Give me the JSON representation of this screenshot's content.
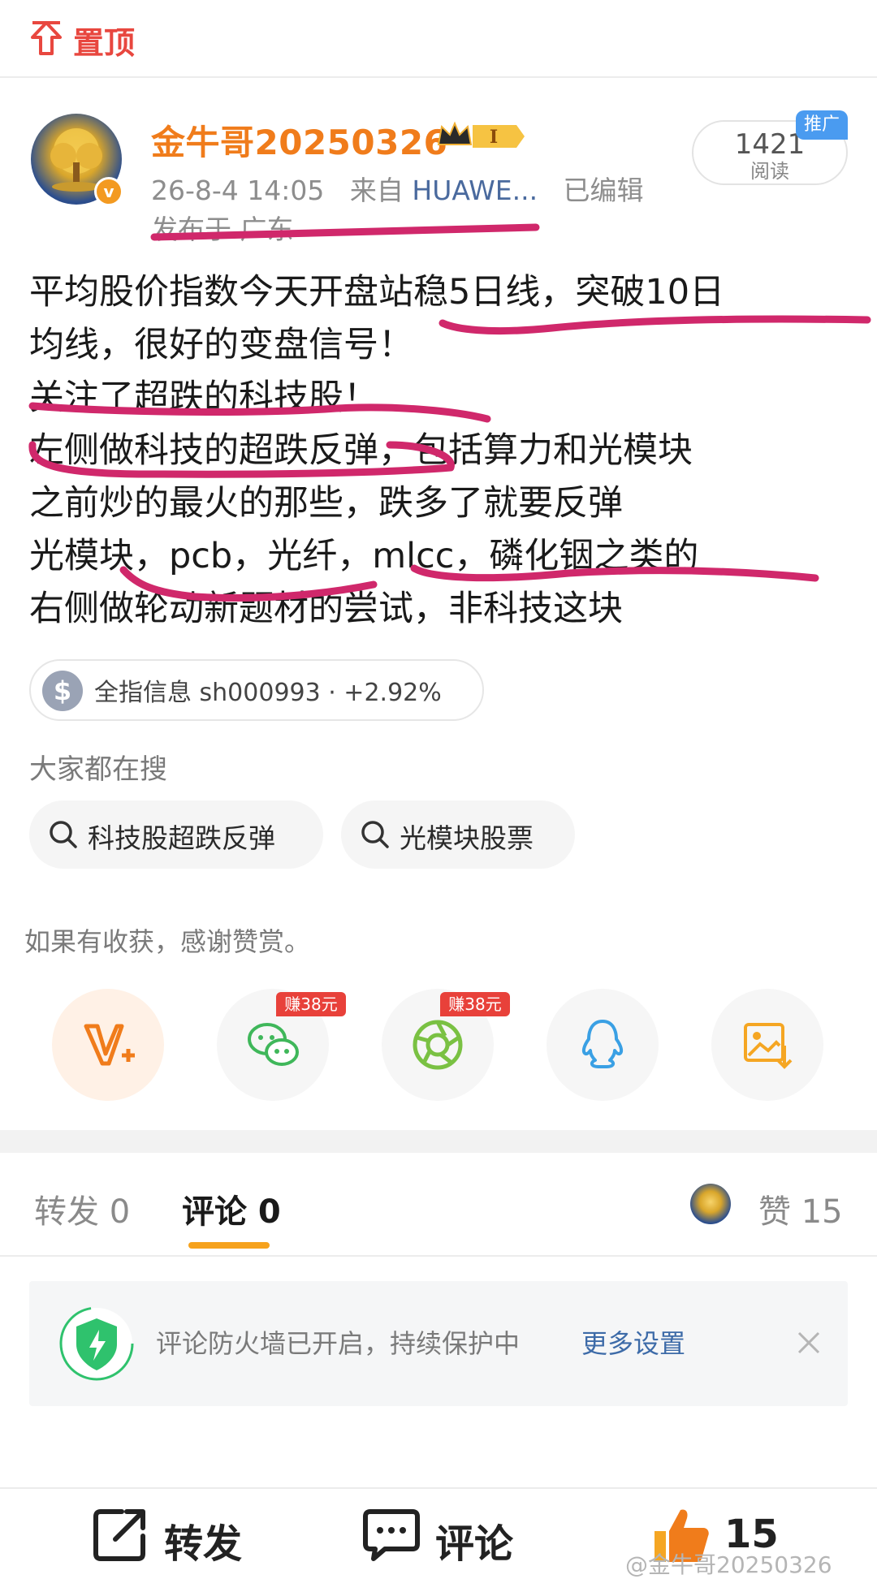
{
  "topbar": {
    "pin_label": "置顶"
  },
  "post": {
    "username": "金牛哥20250326",
    "level_badge": "I",
    "timestamp": "26-8-4 14:05",
    "from_label": "来自",
    "device": "HUAWE...",
    "edited": "已编辑",
    "location": "发布于 广东",
    "read_count": "1421",
    "read_label": "阅读",
    "promo_tag": "推广",
    "body_lines": [
      "平均股价指数今天开盘站稳5日线，突破10日",
      "均线，很好的变盘信号！",
      "关注了超跌的科技股！",
      "左侧做科技的超跌反弹，包括算力和光模块",
      "之前炒的最火的那些，跌多了就要反弹",
      "光模块，pcb，光纤，mlcc，磷化铟之类的",
      "右侧做轮动新题材的尝试，非科技这块"
    ],
    "stock_chip": "全指信息 sh000993 · +2.92%"
  },
  "search": {
    "title": "大家都在搜",
    "chips": [
      "科技股超跌反弹",
      "光模块股票"
    ]
  },
  "reward_tip": "如果有收获，感谢赞赏。",
  "share": {
    "earn_tag": "赚38元",
    "buttons": [
      "reward",
      "wechat",
      "moments",
      "qq",
      "save-image"
    ]
  },
  "tabs": {
    "repost": "转发 0",
    "comment": "评论 0",
    "like": "赞 15"
  },
  "firewall": {
    "text": "评论防火墙已开启，持续保护中",
    "link": "更多设置"
  },
  "bottom_bar": {
    "repost": "转发",
    "comment": "评论",
    "like_count": "15"
  },
  "watermark": "@金牛哥20250326",
  "colors": {
    "username": "#f07c1b",
    "accent_orange": "#f6a21d",
    "annotation": "#d0286b",
    "link_blue": "#3d6ba8",
    "pin_red": "#e8473f"
  }
}
